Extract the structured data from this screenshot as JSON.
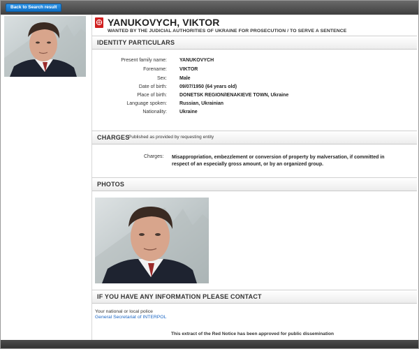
{
  "nav": {
    "back_label": "Back to Search result"
  },
  "header": {
    "name": "YANUKOVYCH, VIKTOR",
    "wanted_by": "WANTED BY THE JUDICIAL AUTHORITIES OF UKRAINE FOR PROSECUTION / TO SERVE A SENTENCE",
    "emblem_icon": "interpol-emblem-icon"
  },
  "identity": {
    "title": "IDENTITY PARTICULARS",
    "rows": [
      {
        "label": "Present family name:",
        "value": "YANUKOVYCH"
      },
      {
        "label": "Forename:",
        "value": "VIKTOR"
      },
      {
        "label": "Sex:",
        "value": "Male"
      },
      {
        "label": "Date of birth:",
        "value": "09/07/1950 (64 years old)"
      },
      {
        "label": "Place of birth:",
        "value": "DONETSK REGION/IENAKIEVE TOWN, Ukraine"
      },
      {
        "label": "Language spoken:",
        "value": "Russian, Ukrainian"
      },
      {
        "label": "Nationality:",
        "value": "Ukraine"
      }
    ]
  },
  "charges": {
    "title": "CHARGES",
    "subtitle": "Published as provided by requesting entity",
    "label": "Charges:",
    "text": "Misappropriation, embezzlement or conversion of property by malversation, if committed in respect of an especially gross amount, or by an organized group."
  },
  "photos": {
    "title": "PHOTOS"
  },
  "contact": {
    "title": "IF YOU HAVE ANY INFORMATION PLEASE CONTACT",
    "line1": "Your national or local police",
    "link": "General Secretariat of INTERPOL"
  },
  "footer": {
    "note": "This extract of the Red Notice has been approved for public dissemination"
  },
  "colors": {
    "accent": "#d01f1f",
    "link": "#1a66c4",
    "button": "#1a7fd4"
  }
}
